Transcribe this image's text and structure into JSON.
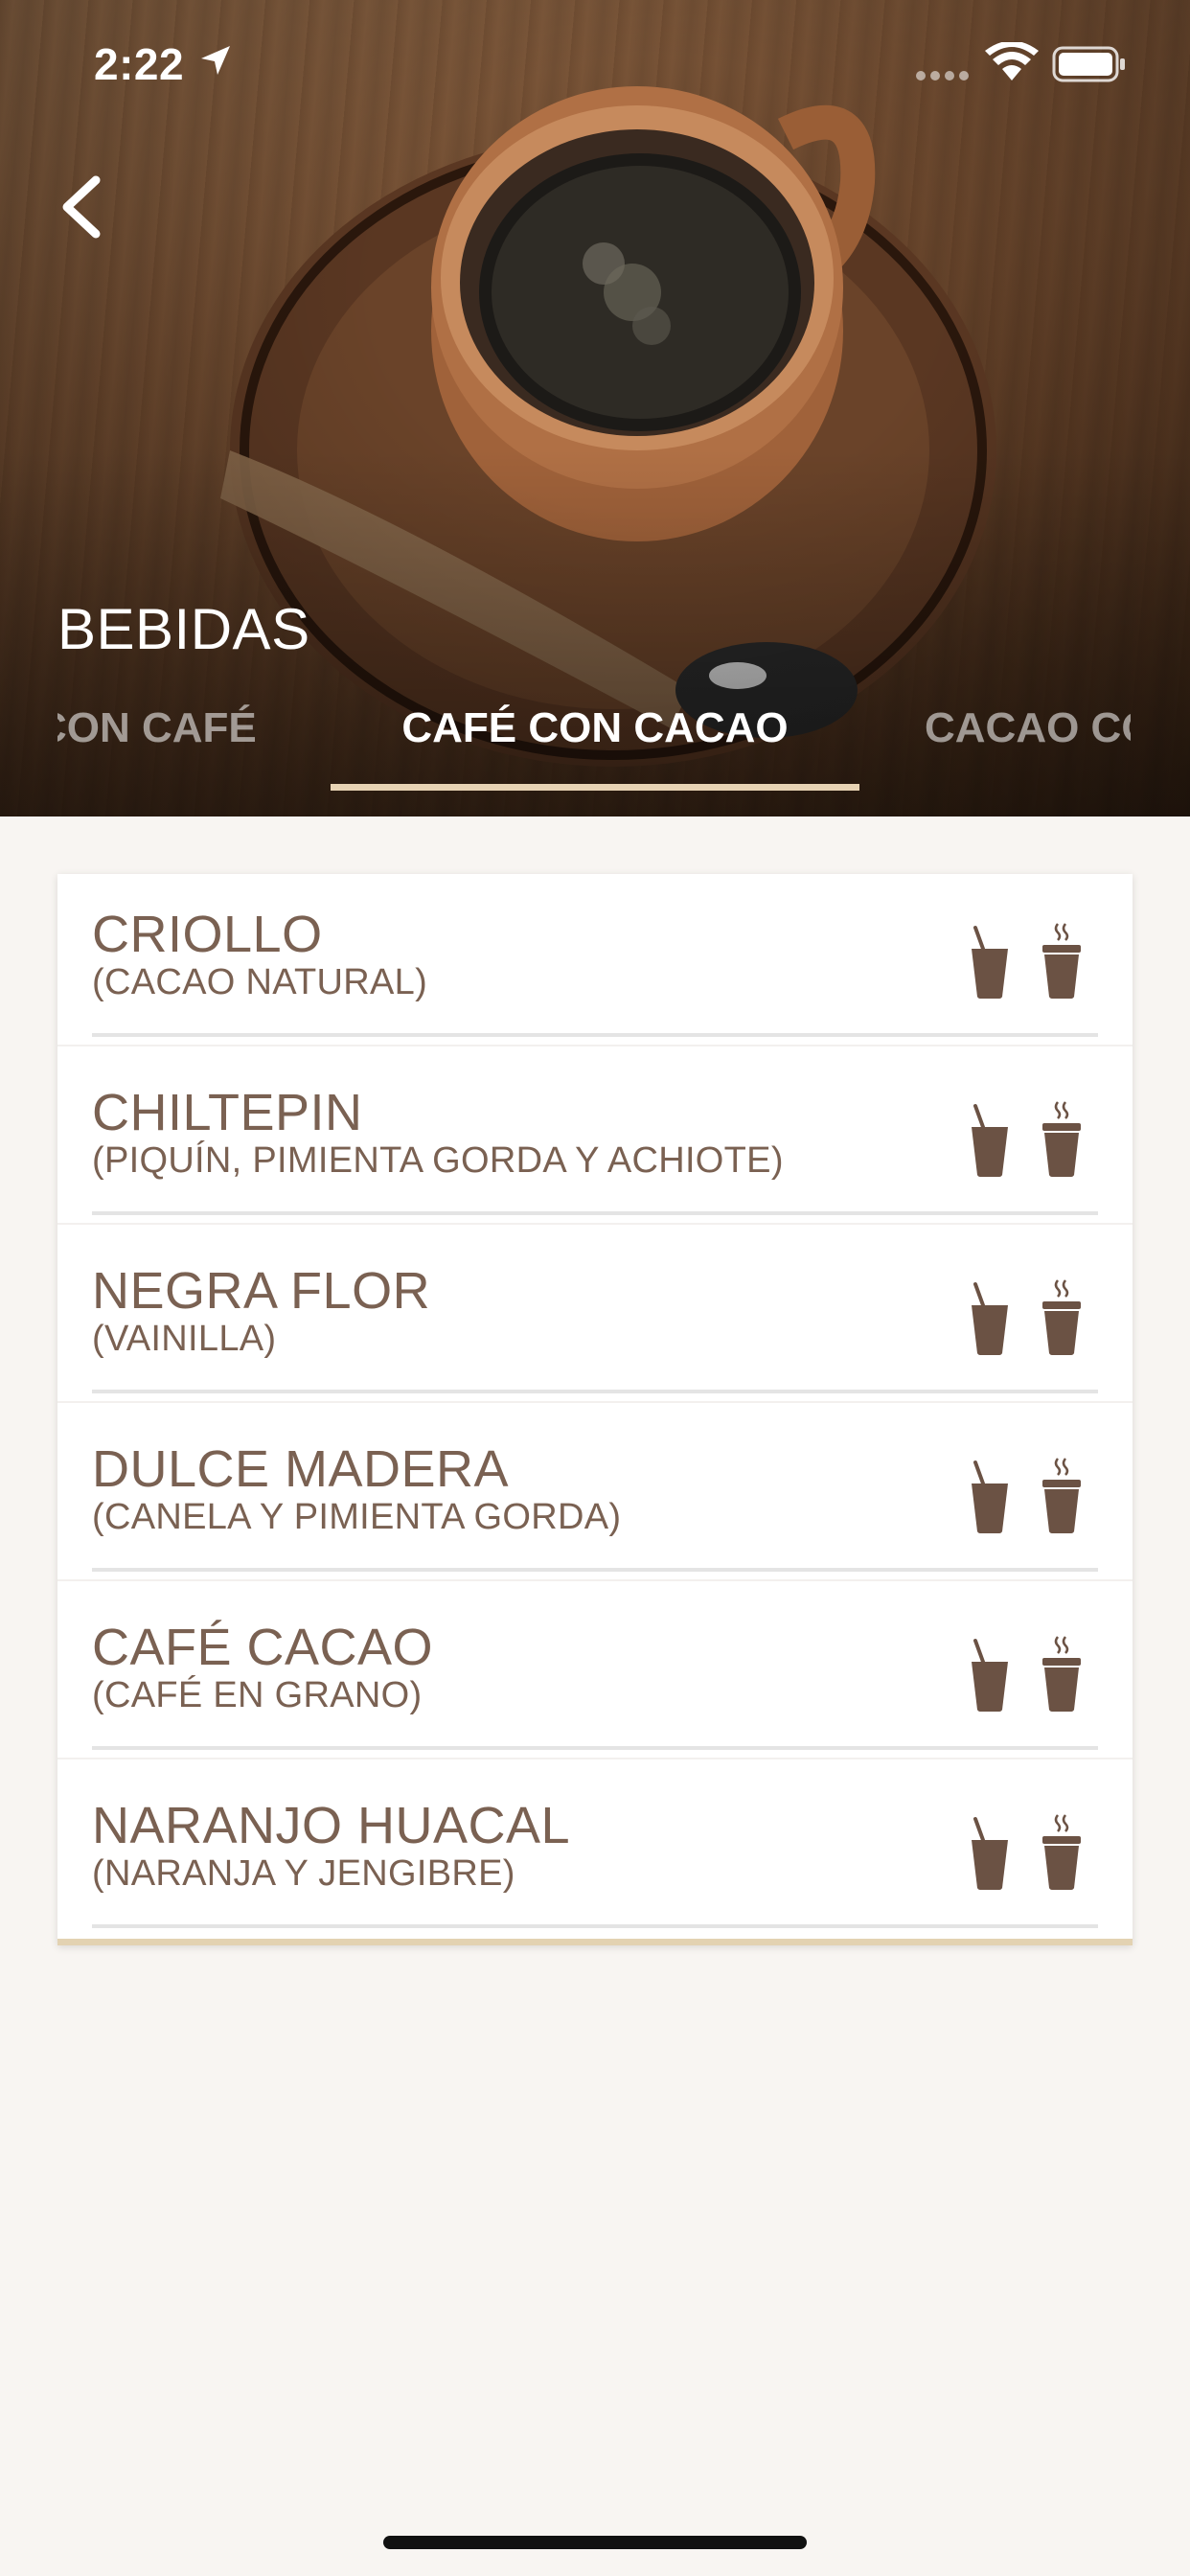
{
  "status_bar": {
    "time": "2:22"
  },
  "header": {
    "title": "BEBIDAS",
    "tabs": [
      {
        "label": "CON CAFÉ",
        "active": false
      },
      {
        "label": "CAFÉ CON CACAO",
        "active": true
      },
      {
        "label": "CACAO CON",
        "active": false
      }
    ]
  },
  "drinks": [
    {
      "name": "CRIOLLO",
      "description": "(CACAO NATURAL)"
    },
    {
      "name": "CHILTEPIN",
      "description": "(PIQUÍN, PIMIENTA GORDA Y ACHIOTE)"
    },
    {
      "name": "NEGRA FLOR",
      "description": "(VAINILLA)"
    },
    {
      "name": "DULCE MADERA",
      "description": "(CANELA Y PIMIENTA GORDA)"
    },
    {
      "name": "CAFÉ CACAO",
      "description": "(CAFÉ EN GRANO)"
    },
    {
      "name": "NARANJO HUACAL",
      "description": "(NARANJA Y JENGIBRE)"
    }
  ],
  "colors": {
    "text": "#7a6152",
    "icon": "#6b5244",
    "accent": "#e3d2b2",
    "background": "#f8f5f2"
  }
}
